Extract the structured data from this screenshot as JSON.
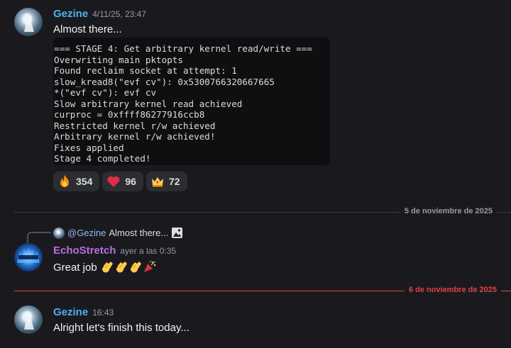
{
  "colors": {
    "background": "#1a1a1e",
    "name_gezine": "#4fb1ee",
    "name_echo": "#b76fe0",
    "new_divider": "#e0424a"
  },
  "message1": {
    "author": "Gezine",
    "timestamp": "4/11/25, 23:47",
    "text": "Almost there...",
    "code_lines": [
      "=== STAGE 4: Get arbitrary kernel read/write ===",
      "Overwriting main pktopts",
      "Found reclaim socket at attempt: 1",
      "slow_kread8(\"evf cv\"): 0x5300766320667665",
      "*(\"evf cv\"): evf cv",
      "Slow arbitrary kernel read achieved",
      "curproc = 0xffff86277916ccb8",
      "Restricted kernel r/w achieved",
      "Arbitrary kernel r/w achieved!",
      "Fixes applied",
      "Stage 4 completed!"
    ],
    "reactions": [
      {
        "emoji": "fire-icon",
        "count": "354"
      },
      {
        "emoji": "red-heart-icon",
        "count": "96"
      },
      {
        "emoji": "crown-icon",
        "count": "72"
      }
    ]
  },
  "divider1": {
    "label": "5 de noviembre de 2025"
  },
  "message2": {
    "reply": {
      "mention": "@Gezine",
      "text": "Almost there...",
      "attachment_icon": "image-icon"
    },
    "author": "EchoStretch",
    "timestamp": "ayer a las 0:35",
    "text": "Great job",
    "emojis": [
      "clapping-hands-icon",
      "clapping-hands-icon",
      "clapping-hands-icon",
      "party-popper-icon"
    ]
  },
  "divider2": {
    "label": "6 de noviembre de 2025"
  },
  "message3": {
    "author": "Gezine",
    "timestamp": "16:43",
    "text": "Alright let's finish this today..."
  }
}
